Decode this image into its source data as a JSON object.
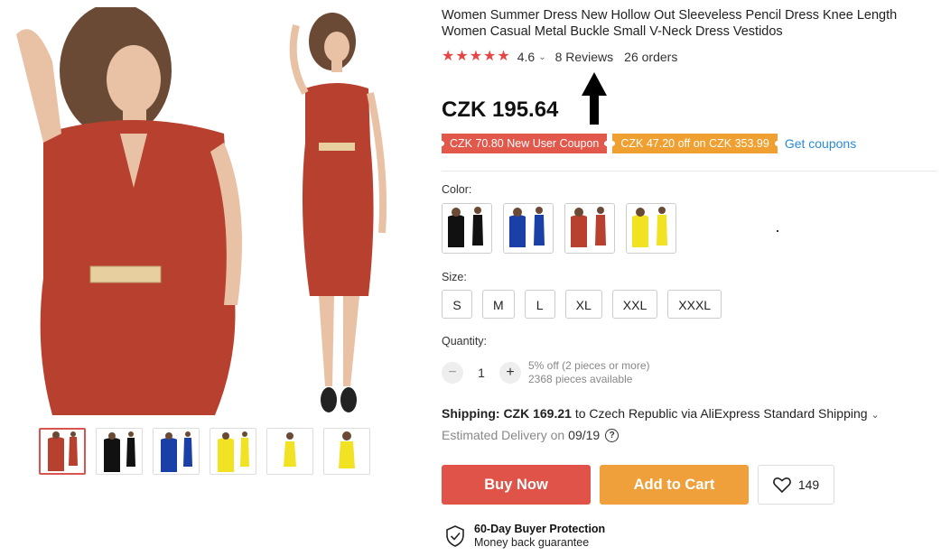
{
  "product": {
    "title": "Women Summer Dress New Hollow Out Sleeveless Pencil Dress Knee Length Women Casual Metal Buckle Small V-Neck Dress Vestidos",
    "rating": "4.6",
    "reviews": "8 Reviews",
    "orders": "26 orders",
    "price": "CZK 195.64"
  },
  "coupons": {
    "new_user": "CZK 70.80 New User Coupon",
    "discount": "CZK 47.20 off on CZK 353.99",
    "get": "Get coupons"
  },
  "colors": {
    "label": "Color:",
    "options": [
      "black",
      "blue",
      "red",
      "yellow"
    ]
  },
  "sizes": {
    "label": "Size:",
    "options": [
      "S",
      "M",
      "L",
      "XL",
      "XXL",
      "XXXL"
    ]
  },
  "quantity": {
    "label": "Quantity:",
    "value": "1",
    "discount": "5% off (2 pieces or more)",
    "available": "2368 pieces available"
  },
  "shipping": {
    "label": "Shipping:",
    "price": "CZK 169.21",
    "rest": "to Czech Republic via AliExpress Standard Shipping",
    "eta_label": "Estimated Delivery on",
    "eta_date": "09/19"
  },
  "actions": {
    "buy": "Buy Now",
    "cart": "Add to Cart",
    "wish_count": "149"
  },
  "protection": {
    "title": "60-Day Buyer Protection",
    "sub": "Money back guarantee"
  },
  "theme": {
    "accent_red": "#e05348",
    "accent_orange": "#f0a03b",
    "link_blue": "#2a8ad6",
    "dress_red": "#b8402f"
  }
}
